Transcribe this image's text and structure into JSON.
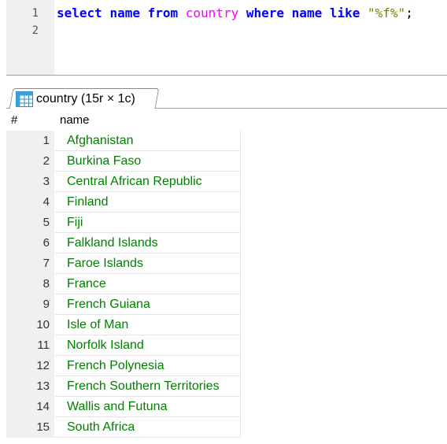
{
  "editor": {
    "line_numbers": [
      "1",
      "2"
    ],
    "query_tokens": [
      {
        "text": "select",
        "kind": "kw"
      },
      {
        "text": " ",
        "kind": "id"
      },
      {
        "text": "name",
        "kind": "kw"
      },
      {
        "text": " ",
        "kind": "id"
      },
      {
        "text": "from",
        "kind": "kw"
      },
      {
        "text": " ",
        "kind": "id"
      },
      {
        "text": "country",
        "kind": "tbl"
      },
      {
        "text": " ",
        "kind": "id"
      },
      {
        "text": "where",
        "kind": "kw"
      },
      {
        "text": " ",
        "kind": "id"
      },
      {
        "text": "name",
        "kind": "kw"
      },
      {
        "text": " ",
        "kind": "id"
      },
      {
        "text": "like",
        "kind": "kw"
      },
      {
        "text": " ",
        "kind": "id"
      },
      {
        "text": "\"%f%\"",
        "kind": "str"
      },
      {
        "text": ";",
        "kind": "punc"
      }
    ]
  },
  "results_tab": {
    "label": "country (15r × 1c)",
    "icon": "grid-table-icon"
  },
  "grid": {
    "header_num": "#",
    "header_col": "name",
    "rows": [
      {
        "n": "1",
        "name": "Afghanistan"
      },
      {
        "n": "2",
        "name": "Burkina Faso"
      },
      {
        "n": "3",
        "name": "Central African Republic"
      },
      {
        "n": "4",
        "name": "Finland"
      },
      {
        "n": "5",
        "name": "Fiji"
      },
      {
        "n": "6",
        "name": "Falkland Islands"
      },
      {
        "n": "7",
        "name": "Faroe Islands"
      },
      {
        "n": "8",
        "name": "France"
      },
      {
        "n": "9",
        "name": "French Guiana"
      },
      {
        "n": "10",
        "name": "Isle of Man"
      },
      {
        "n": "11",
        "name": "Norfolk Island"
      },
      {
        "n": "12",
        "name": "French Polynesia"
      },
      {
        "n": "13",
        "name": "French Southern Territories"
      },
      {
        "n": "14",
        "name": "Wallis and Futuna"
      },
      {
        "n": "15",
        "name": "South Africa"
      }
    ]
  },
  "colors": {
    "keyword": "#0000ff",
    "table_identifier": "#ff00ff",
    "string": "#808000",
    "cell_text": "#008000",
    "gutter_bg": "#f0f0f0"
  }
}
